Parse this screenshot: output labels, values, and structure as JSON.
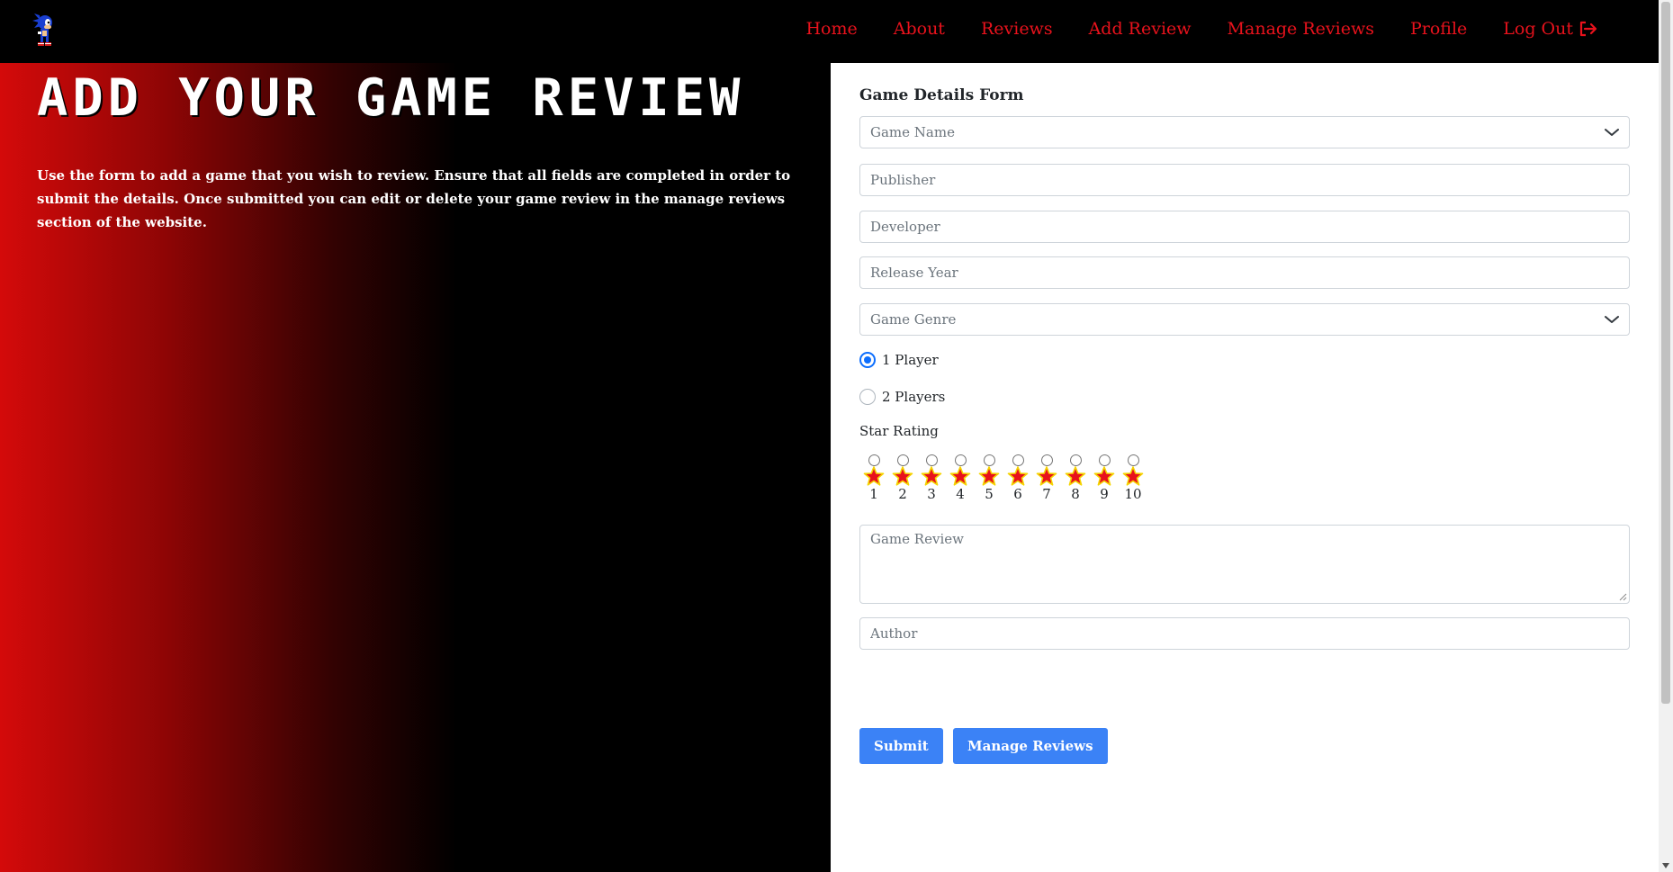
{
  "nav": {
    "logo_icon": "sonic-sprite-logo",
    "links": [
      "Home",
      "About",
      "Reviews",
      "Add Review",
      "Manage Reviews",
      "Profile",
      "Log Out"
    ],
    "link_color": "#e8121c",
    "logout_icon": "sign-out-icon"
  },
  "hero": {
    "title": "ADD YOUR GAME REVIEW",
    "description": "Use the form to add a game that you wish to review. Ensure that all fields are completed in order to submit the details. Once submitted you can edit or delete your game review in the manage reviews section of the website."
  },
  "form": {
    "title": "Game Details Form",
    "game_name_placeholder": "Game Name",
    "publisher_placeholder": "Publisher",
    "developer_placeholder": "Developer",
    "release_year_placeholder": "Release Year",
    "genre_placeholder": "Game Genre",
    "players": {
      "options": [
        "1 Player",
        "2 Players"
      ],
      "selected": "1 Player"
    },
    "star_rating_label": "Star Rating",
    "star_ratings": [
      "1",
      "2",
      "3",
      "4",
      "5",
      "6",
      "7",
      "8",
      "9",
      "10"
    ],
    "review_placeholder": "Game Review",
    "author_placeholder": "Author",
    "submit_label": "Submit",
    "manage_label": "Manage Reviews",
    "button_color": "#3b82f6"
  }
}
